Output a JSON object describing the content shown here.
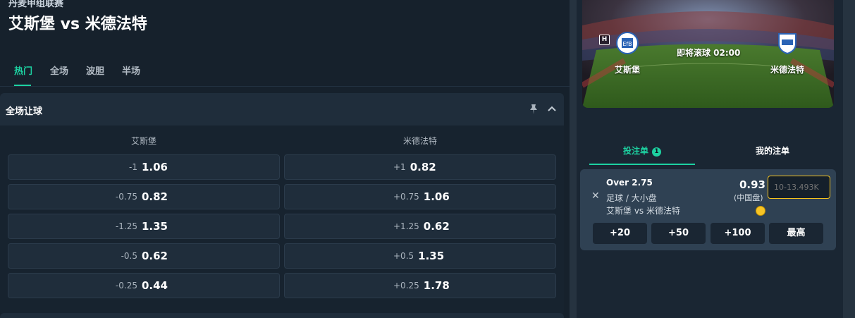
{
  "match": {
    "league": "丹麦甲组联赛",
    "title": "艾斯堡 vs 米德法特",
    "home_team": "艾斯堡",
    "away_team": "米德法特",
    "kickoff_text": "即将滚球 02:00",
    "home_badge": "H"
  },
  "tabs": [
    {
      "label": "热门",
      "active": true
    },
    {
      "label": "全场",
      "active": false
    },
    {
      "label": "波胆",
      "active": false
    },
    {
      "label": "半场",
      "active": false
    }
  ],
  "market": {
    "title": "全场让球",
    "columns": [
      "艾斯堡",
      "米德法特"
    ],
    "rows": [
      {
        "home_hcap": "-1",
        "home_price": "1.06",
        "away_hcap": "+1",
        "away_price": "0.82"
      },
      {
        "home_hcap": "-0.75",
        "home_price": "0.82",
        "away_hcap": "+0.75",
        "away_price": "1.06"
      },
      {
        "home_hcap": "-1.25",
        "home_price": "1.35",
        "away_hcap": "+1.25",
        "away_price": "0.62"
      },
      {
        "home_hcap": "-0.5",
        "home_price": "0.62",
        "away_hcap": "+0.5",
        "away_price": "1.35"
      },
      {
        "home_hcap": "-0.25",
        "home_price": "0.44",
        "away_hcap": "+0.25",
        "away_price": "1.78"
      }
    ]
  },
  "betslip": {
    "tabs": [
      {
        "label": "投注单",
        "count": "1",
        "active": true
      },
      {
        "label": "我的注单",
        "active": false
      }
    ],
    "selection": {
      "name": "Over 2.75",
      "market": "足球 / 大小盘",
      "event": "艾斯堡 vs 米德法特",
      "odds": "0.93",
      "odds_type": "(中国盘)",
      "stake_placeholder": "10-13.493K"
    },
    "quick_stakes": [
      "+20",
      "+50",
      "+100",
      "最高"
    ]
  },
  "colors": {
    "accent": "#1dd1a1",
    "background": "#15202b",
    "card": "#1f2d3b",
    "input_border": "#f4c21e"
  }
}
